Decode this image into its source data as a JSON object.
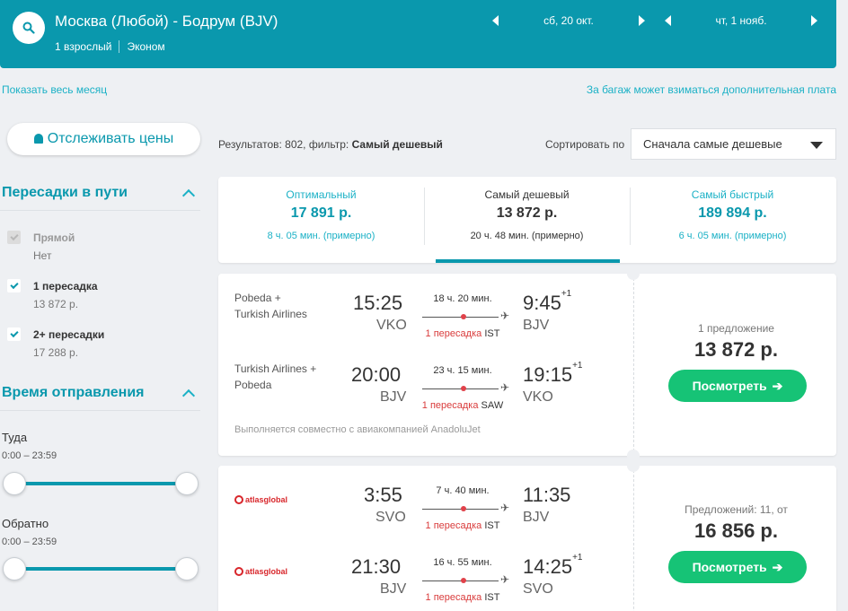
{
  "header": {
    "route": "Москва (Любой) - Бодрум (BJV)",
    "passengers": "1 взрослый",
    "cabin": "Эконом",
    "depart_date": "сб, 20 окт.",
    "return_date": "чт, 1 нояб."
  },
  "links": {
    "show_month": "Показать весь месяц",
    "baggage_note": "За багаж может взиматься дополнительная плата"
  },
  "sidebar": {
    "track_prices": "Отслеживать цены",
    "stops_title": "Пересадки в пути",
    "stops": [
      {
        "label": "Прямой",
        "sub": "Нет",
        "checked": true,
        "disabled": true
      },
      {
        "label": "1 пересадка",
        "sub": "13 872 р.",
        "checked": true,
        "disabled": false
      },
      {
        "label": "2+ пересадки",
        "sub": "17 288 р.",
        "checked": true,
        "disabled": false
      }
    ],
    "dep_time_title": "Время отправления",
    "outbound_label": "Туда",
    "outbound_range": "0:00 – 23:59",
    "return_label": "Обратно",
    "return_range": "0:00 – 23:59"
  },
  "results": {
    "summary_prefix": "Результатов: 802, фильтр:",
    "summary_filter": "Самый дешевый",
    "sort_label": "Сортировать по",
    "sort_value": "Сначала самые дешевые"
  },
  "tabs": [
    {
      "title": "Оптимальный",
      "price": "17 891 р.",
      "duration": "8 ч. 05 мин. (примерно)"
    },
    {
      "title": "Самый дешевый",
      "price": "13 872 р.",
      "duration": "20 ч. 48 мин. (примерно)"
    },
    {
      "title": "Самый быстрый",
      "price": "189 894 р.",
      "duration": "6 ч. 05 мин. (примерно)"
    }
  ],
  "cards": [
    {
      "legs": [
        {
          "airline": "Pobeda +\nTurkish Airlines",
          "dep_time": "15:25",
          "dep_ap": "VKO",
          "duration": "18 ч. 20 мин.",
          "arr_time": "9:45",
          "arr_plus": "+1",
          "arr_ap": "BJV",
          "stop_text": "1 пересадка",
          "stop_iata": "IST"
        },
        {
          "airline": "Turkish Airlines +\nPobeda",
          "dep_time": "20:00",
          "dep_ap": "BJV",
          "duration": "23 ч. 15 мин.",
          "arr_time": "19:15",
          "arr_plus": "+1",
          "arr_ap": "VKO",
          "stop_text": "1 пересадка",
          "stop_iata": "SAW"
        }
      ],
      "joint": "Выполняется совместно с авиакомпанией AnadoluJet",
      "offers": "1 предложение",
      "price": "13 872 р.",
      "button": "Посмотреть"
    },
    {
      "legs": [
        {
          "airline_logo": "atlasglobal",
          "dep_time": "3:55",
          "dep_ap": "SVO",
          "duration": "7 ч. 40 мин.",
          "arr_time": "11:35",
          "arr_plus": "",
          "arr_ap": "BJV",
          "stop_text": "1 пересадка",
          "stop_iata": "IST"
        },
        {
          "airline_logo": "atlasglobal",
          "dep_time": "21:30",
          "dep_ap": "BJV",
          "duration": "16 ч. 55 мин.",
          "arr_time": "14:25",
          "arr_plus": "+1",
          "arr_ap": "SVO",
          "stop_text": "1 пересадка",
          "stop_iata": "IST"
        }
      ],
      "offers": "Предложений: 11, от",
      "price": "16 856 р.",
      "button": "Посмотреть"
    }
  ],
  "icons": {
    "search": "search-icon",
    "bell": "bell-icon",
    "plane": "plane-icon"
  },
  "colors": {
    "brand": "#0a98ad",
    "accent_light": "#1bb1c6",
    "cta": "#16c376",
    "stop_red": "#d93c3c"
  }
}
